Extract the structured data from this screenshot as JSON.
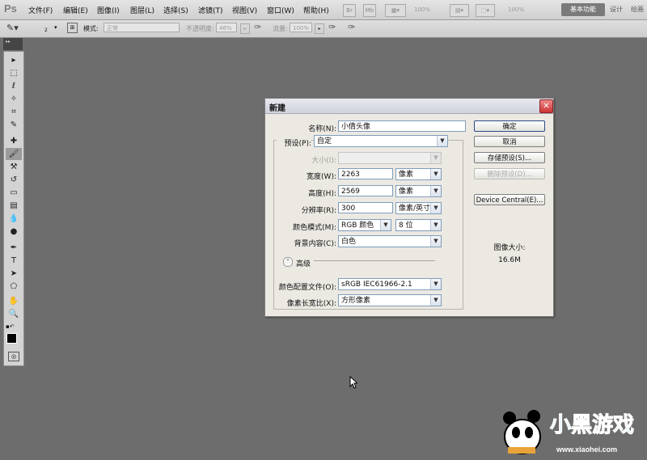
{
  "app": {
    "logo": "Ps"
  },
  "menu": [
    "文件(F)",
    "编辑(E)",
    "图像(I)",
    "图层(L)",
    "选择(S)",
    "滤镜(T)",
    "视图(V)",
    "窗口(W)",
    "帮助(H)"
  ],
  "menubar_controls": {
    "zoom_value": "100%",
    "zoom2_value": "100%"
  },
  "workspaces": [
    "基本功能",
    "设计",
    "绘画"
  ],
  "options_bar": {
    "brush_size": "2",
    "mode_label": "模式:",
    "mode_value": "正常",
    "opacity_label": "不透明度:",
    "opacity_value": "46%",
    "flow_label": "流量:",
    "flow_value": "100%"
  },
  "toolbox": {
    "tools": [
      "move-icon",
      "marquee-icon",
      "lasso-icon",
      "quick-select-icon",
      "crop-icon",
      "eyedropper-icon",
      "healing-icon",
      "brush-icon",
      "stamp-icon",
      "history-brush-icon",
      "eraser-icon",
      "gradient-icon",
      "blur-icon",
      "dodge-icon",
      "pen-icon",
      "type-icon",
      "path-select-icon",
      "shape-icon",
      "hand-icon",
      "zoom-icon"
    ],
    "glyphs": [
      "▸",
      "⬚",
      "ℓ",
      "✧",
      "⌗",
      "✎",
      "✚",
      "🖌",
      "⚒",
      "↺",
      "▭",
      "▤",
      "💧",
      "●",
      "✒",
      "T",
      "➤",
      "⬠",
      "✋",
      "🔍"
    ]
  },
  "dialog": {
    "title": "新建",
    "name_label": "名称(N):",
    "name_value": "小倩头像",
    "preset_label": "预设(P):",
    "preset_value": "自定",
    "size_label": "大小(I):",
    "size_value": "",
    "width_label": "宽度(W):",
    "width_value": "2263",
    "width_unit": "像素",
    "height_label": "高度(H):",
    "height_value": "2569",
    "height_unit": "像素",
    "resolution_label": "分辨率(R):",
    "resolution_value": "300",
    "resolution_unit": "像素/英寸",
    "color_mode_label": "颜色模式(M):",
    "color_mode_value": "RGB 颜色",
    "bit_depth_value": "8 位",
    "background_label": "背景内容(C):",
    "background_value": "白色",
    "advanced_label": "高级",
    "profile_label": "颜色配置文件(O):",
    "profile_value": "sRGB IEC61966-2.1",
    "aspect_label": "像素长宽比(X):",
    "aspect_value": "方形像素",
    "buttons": {
      "ok": "确定",
      "cancel": "取消",
      "save_preset": "存储预设(S)...",
      "delete_preset": "删除预设(D)...",
      "device_central": "Device Central(E)..."
    },
    "image_size_label": "图像大小:",
    "image_size_value": "16.6M"
  },
  "watermark": {
    "text": "小黑游戏",
    "url": "www.xiaohei.com"
  }
}
